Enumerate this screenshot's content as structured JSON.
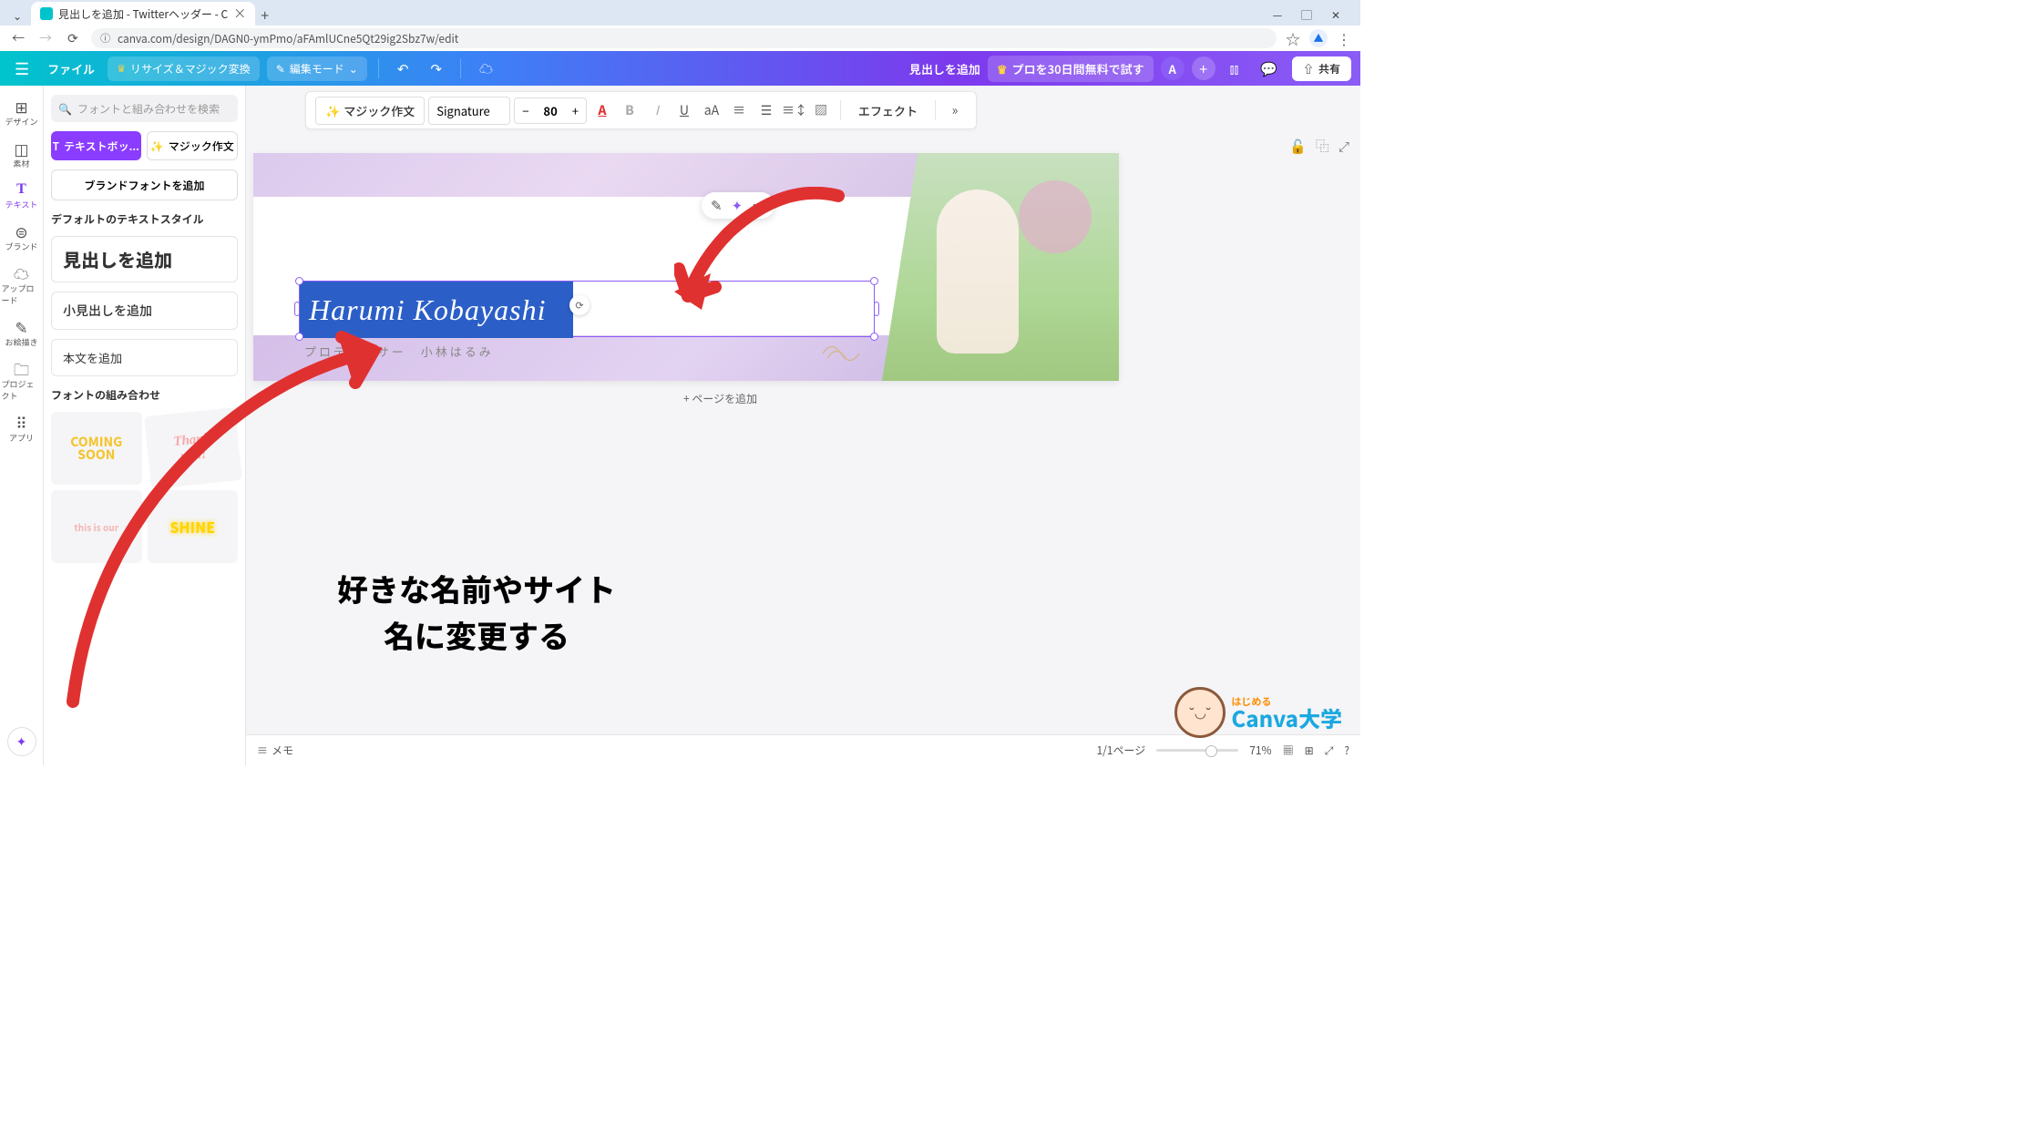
{
  "browser": {
    "tab_title": "見出しを追加 - Twitterヘッダー - C",
    "url": "canva.com/design/DAGN0-ymPmo/aFAmlUCne5Qt29ig2Sbz7w/edit"
  },
  "toolbar": {
    "file": "ファイル",
    "resize": "リサイズ＆マジック変換",
    "edit_mode": "編集モード",
    "doc_title": "見出しを追加",
    "pro_trial": "プロを30日間無料で試す",
    "avatar_letter": "A",
    "share": "共有"
  },
  "rail": {
    "design": "デザイン",
    "elements": "素材",
    "text": "テキスト",
    "brand": "ブランド",
    "upload": "アップロード",
    "draw": "お絵描き",
    "projects": "プロジェクト",
    "apps": "アプリ"
  },
  "panel": {
    "search_placeholder": "フォントと組み合わせを検索",
    "text_box_btn": "テキストボッ...",
    "magic_write_btn": "マジック作文",
    "brand_fonts_btn": "ブランドフォントを追加",
    "default_styles_label": "デフォルトのテキストスタイル",
    "h1": "見出しを追加",
    "h2": "小見出しを追加",
    "body": "本文を追加",
    "combos_label": "フォントの組み合わせ",
    "combo1": "COMING\nSOON",
    "combo2": "Thank\nyou!",
    "combo3": "this is our",
    "combo4": "SHINE"
  },
  "text_toolbar": {
    "magic_write": "マジック作文",
    "font_name": "Signature",
    "font_size": "80",
    "effects": "エフェクト"
  },
  "canvas": {
    "signature_name": "Harumi Kobayashi",
    "subtitle": "プロデューサー　小林はるみ",
    "add_page": "+ ページを追加"
  },
  "bottom": {
    "memo": "メモ",
    "page_indicator": "1/1ページ",
    "zoom": "71%"
  },
  "annotations": {
    "instruction_line1": "好きな名前やサイト",
    "instruction_line2": "名に変更する",
    "wm_l1": "はじめる",
    "wm_l2": "Canva大学"
  }
}
